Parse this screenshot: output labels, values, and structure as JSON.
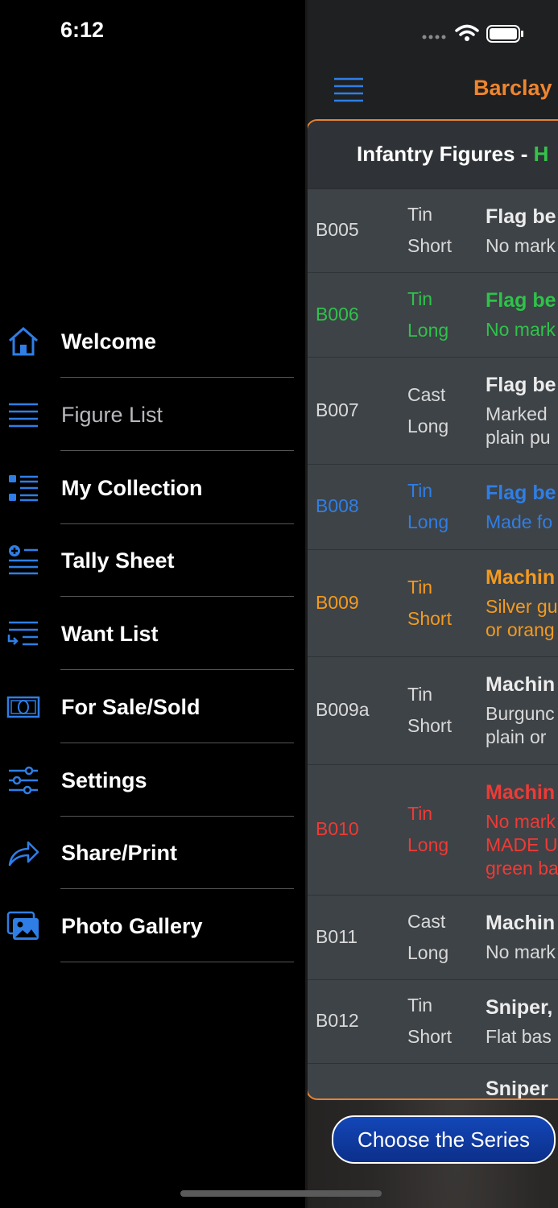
{
  "status": {
    "time": "6:12"
  },
  "drawer": {
    "items": [
      {
        "label": "Welcome",
        "icon": "home-icon"
      },
      {
        "label": "Figure List",
        "icon": "list-lines-icon",
        "dim": true
      },
      {
        "label": "My Collection",
        "icon": "bullet-list-icon"
      },
      {
        "label": "Tally Sheet",
        "icon": "add-list-icon"
      },
      {
        "label": "Want List",
        "icon": "want-list-icon"
      },
      {
        "label": "For Sale/Sold",
        "icon": "money-icon"
      },
      {
        "label": "Settings",
        "icon": "sliders-icon"
      },
      {
        "label": "Share/Print",
        "icon": "share-arrow-icon"
      },
      {
        "label": "Photo Gallery",
        "icon": "photos-icon"
      }
    ],
    "accent_color": "#2f7ee6"
  },
  "navbar": {
    "brand": "Barclay I"
  },
  "panel": {
    "title_main": "Infantry Figures - ",
    "title_accent": "H",
    "rows": [
      {
        "code": "B005",
        "mat1": "Tin",
        "mat2": "Short",
        "title": "Flag be",
        "desc1": "No mark",
        "desc2": "",
        "desc3": "",
        "color": "gray"
      },
      {
        "code": "B006",
        "mat1": "Tin",
        "mat2": "Long",
        "title": "Flag be",
        "desc1": "No mark",
        "desc2": "",
        "desc3": "",
        "color": "green"
      },
      {
        "code": "B007",
        "mat1": "Cast",
        "mat2": "Long",
        "title": "Flag be",
        "desc1": "Marked",
        "desc2": "plain pu",
        "desc3": "",
        "color": "gray"
      },
      {
        "code": "B008",
        "mat1": "Tin",
        "mat2": "Long",
        "title": "Flag be",
        "desc1": "Made fo",
        "desc2": "",
        "desc3": "",
        "color": "blue"
      },
      {
        "code": "B009",
        "mat1": "Tin",
        "mat2": "Short",
        "title": "Machin",
        "desc1": "Silver gu",
        "desc2": "or orang",
        "desc3": "",
        "color": "orange"
      },
      {
        "code": "B009a",
        "mat1": "Tin",
        "mat2": "Short",
        "title": "Machin",
        "desc1": "Burgunc",
        "desc2": "plain or ",
        "desc3": "",
        "color": "gray"
      },
      {
        "code": "B010",
        "mat1": "Tin",
        "mat2": "Long",
        "title": "Machin",
        "desc1": "No mark",
        "desc2": "MADE U",
        "desc3": "green ba",
        "color": "red"
      },
      {
        "code": "B011",
        "mat1": "Cast",
        "mat2": "Long",
        "title": "Machin",
        "desc1": "No mark",
        "desc2": "",
        "desc3": "",
        "color": "gray"
      },
      {
        "code": "B012",
        "mat1": "Tin",
        "mat2": "Short",
        "title": "Sniper,",
        "desc1": "Flat bas",
        "desc2": "",
        "desc3": "",
        "color": "gray"
      },
      {
        "code": "",
        "mat1": "",
        "mat2": "",
        "title": "Sniper",
        "desc1": "",
        "desc2": "",
        "desc3": "",
        "color": "gray"
      }
    ]
  },
  "choose_button": {
    "label": "Choose the Series"
  }
}
